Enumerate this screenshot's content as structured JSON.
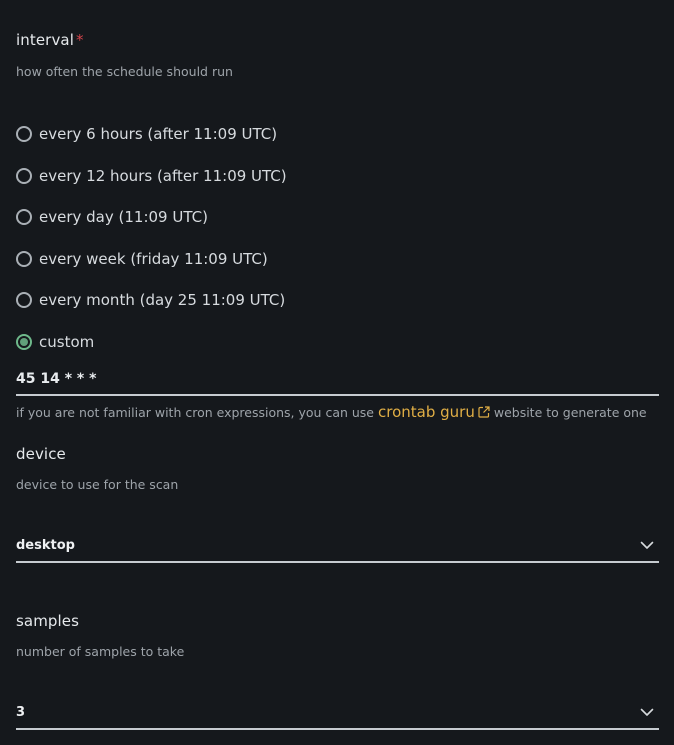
{
  "interval": {
    "label": "interval",
    "required_mark": "*",
    "help": "how often the schedule should run",
    "options": [
      {
        "label": "every 6 hours (after 11:09 UTC)",
        "selected": false
      },
      {
        "label": "every 12 hours (after 11:09 UTC)",
        "selected": false
      },
      {
        "label": "every day (11:09 UTC)",
        "selected": false
      },
      {
        "label": "every week (friday 11:09 UTC)",
        "selected": false
      },
      {
        "label": "every month (day 25 11:09 UTC)",
        "selected": false
      },
      {
        "label": "custom",
        "selected": true
      }
    ],
    "custom_value": "45 14 * * *",
    "hint_before": "if you are not familiar with cron expressions, you can use",
    "hint_link": "crontab guru",
    "hint_after": "website to generate one"
  },
  "device": {
    "label": "device",
    "help": "device to use for the scan",
    "value": "desktop"
  },
  "samples": {
    "label": "samples",
    "help": "number of samples to take",
    "value": "3"
  },
  "colors": {
    "background": "#15181c",
    "accent_radio": "#6fb98b",
    "link": "#e0ae45",
    "required": "#d2434a"
  },
  "icons": {
    "radio": "radio-icon",
    "external_link": "external-link-icon",
    "chevron": "chevron-down-icon"
  }
}
